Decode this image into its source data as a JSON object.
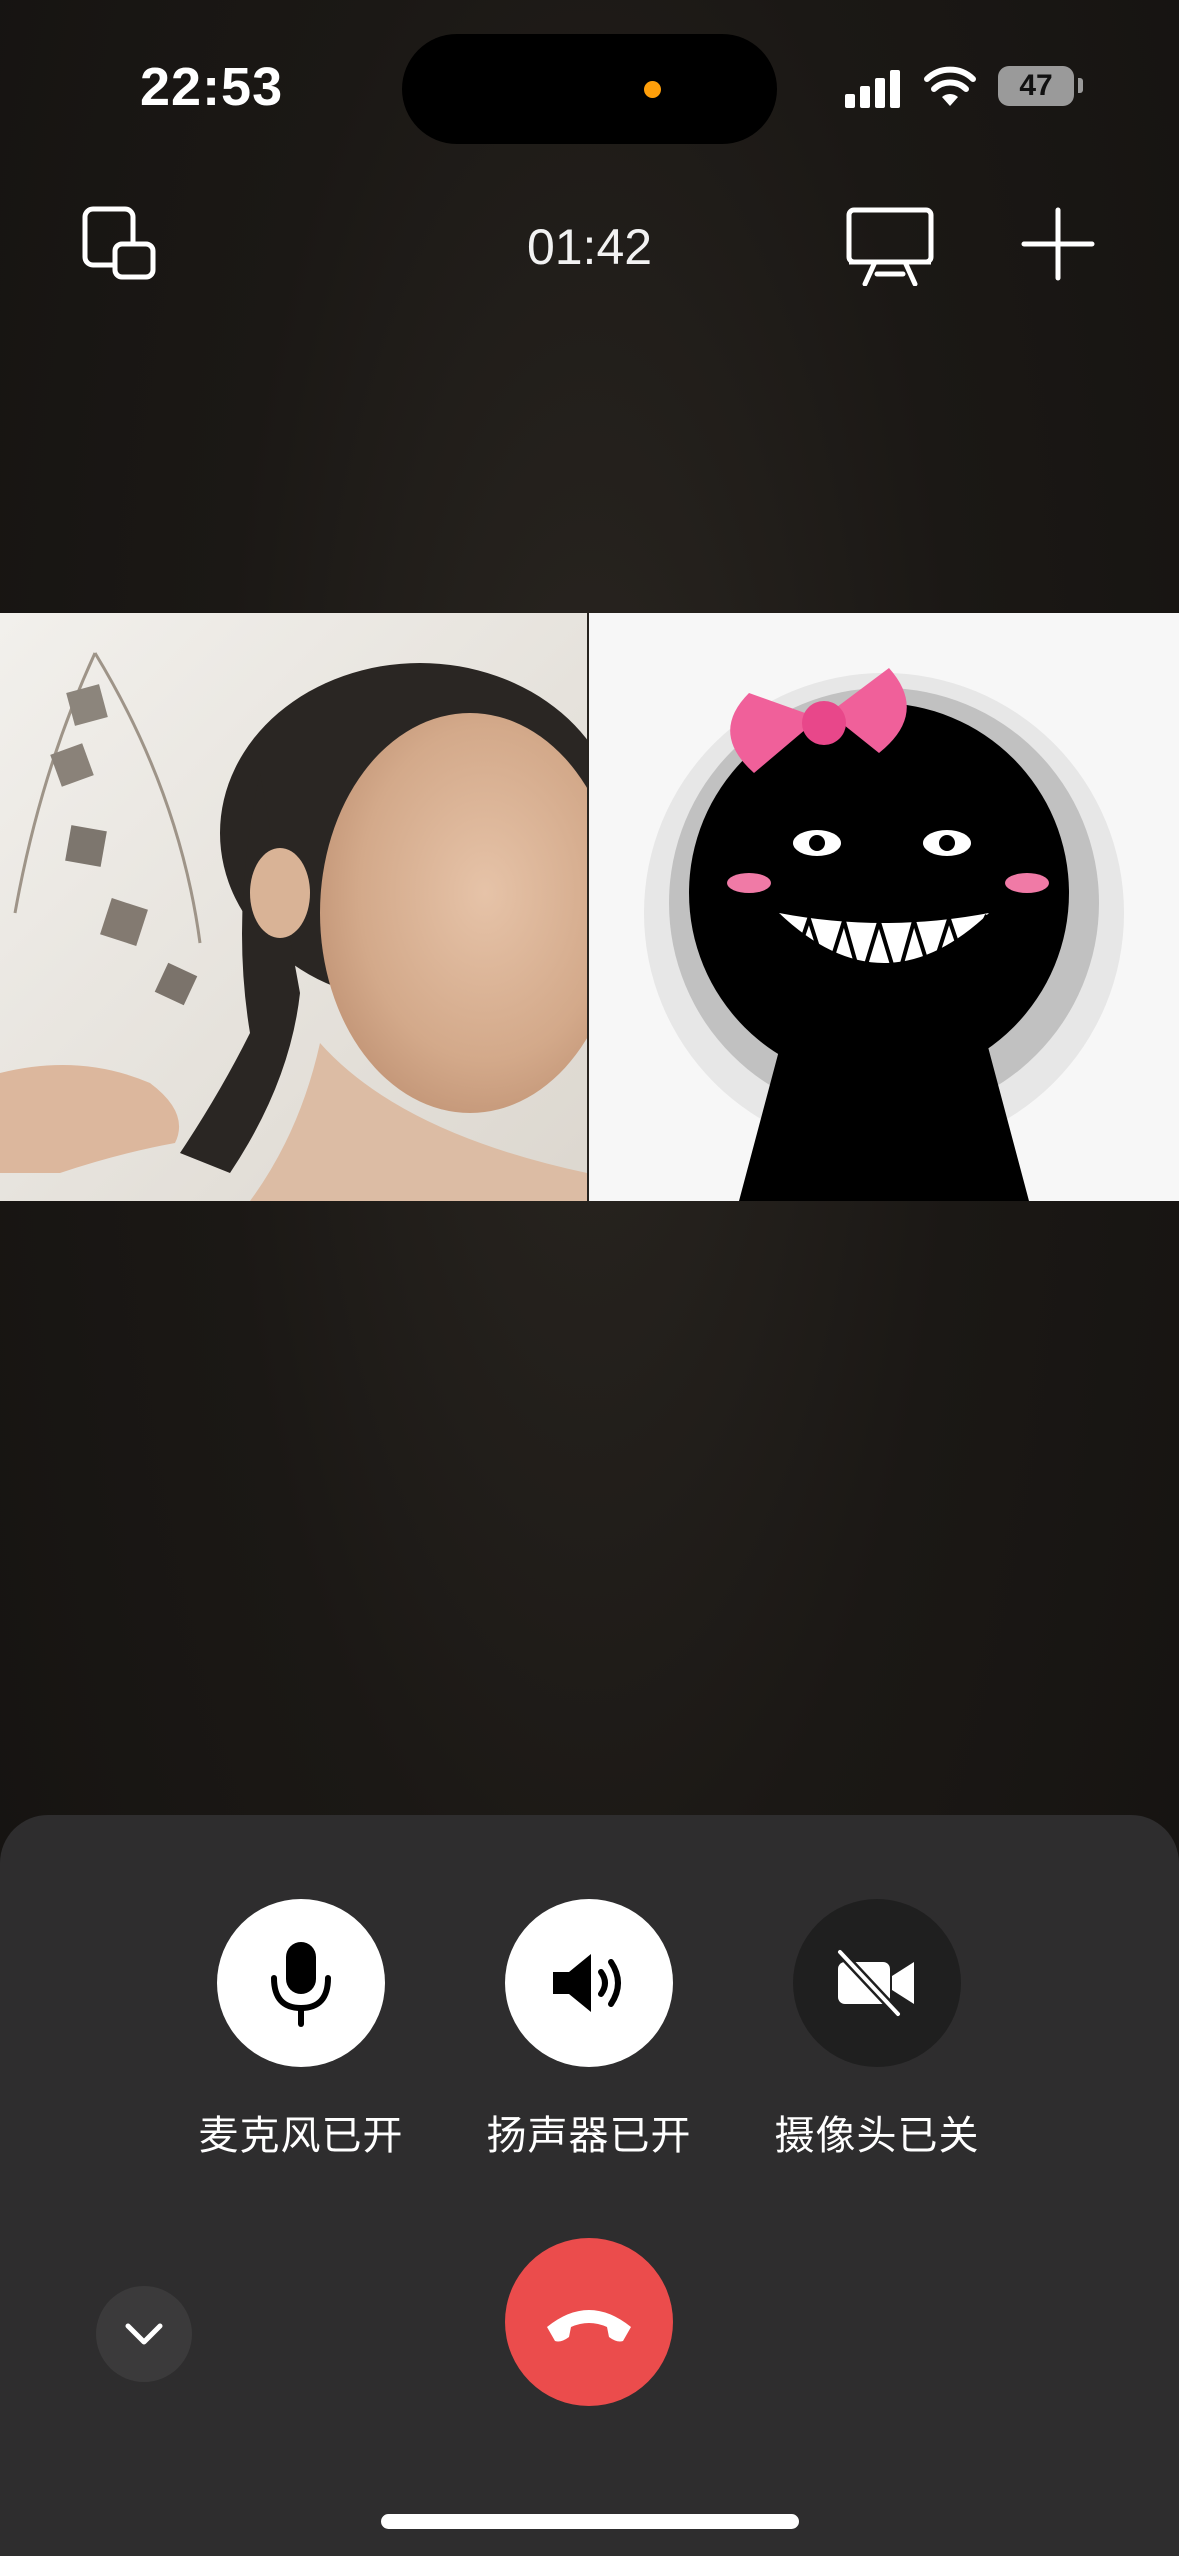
{
  "status_bar": {
    "time": "22:53",
    "battery_level": "47",
    "icons": [
      "signal-icon",
      "wifi-icon",
      "battery-icon"
    ]
  },
  "call_header": {
    "duration": "01:42",
    "icons": [
      "picture-in-picture-icon",
      "screen-share-icon",
      "add-participant-icon"
    ]
  },
  "participants": [
    {
      "tile": "camera-video",
      "kind": "live video"
    },
    {
      "tile": "avatar",
      "kind": "avatar image"
    }
  ],
  "controls": {
    "microphone": {
      "label": "麦克风已开",
      "state": "on",
      "icon": "microphone-icon"
    },
    "speaker": {
      "label": "扬声器已开",
      "state": "on",
      "icon": "speaker-icon"
    },
    "camera": {
      "label": "摄像头已关",
      "state": "off",
      "icon": "camera-off-icon"
    },
    "collapse_icon": "chevron-down-icon",
    "hangup_icon": "hangup-icon"
  },
  "colors": {
    "hangup": "#eb4c4c",
    "panel": "#2e2d2e",
    "island_dot": "#ff9f0a",
    "bow": "#f0609a"
  }
}
